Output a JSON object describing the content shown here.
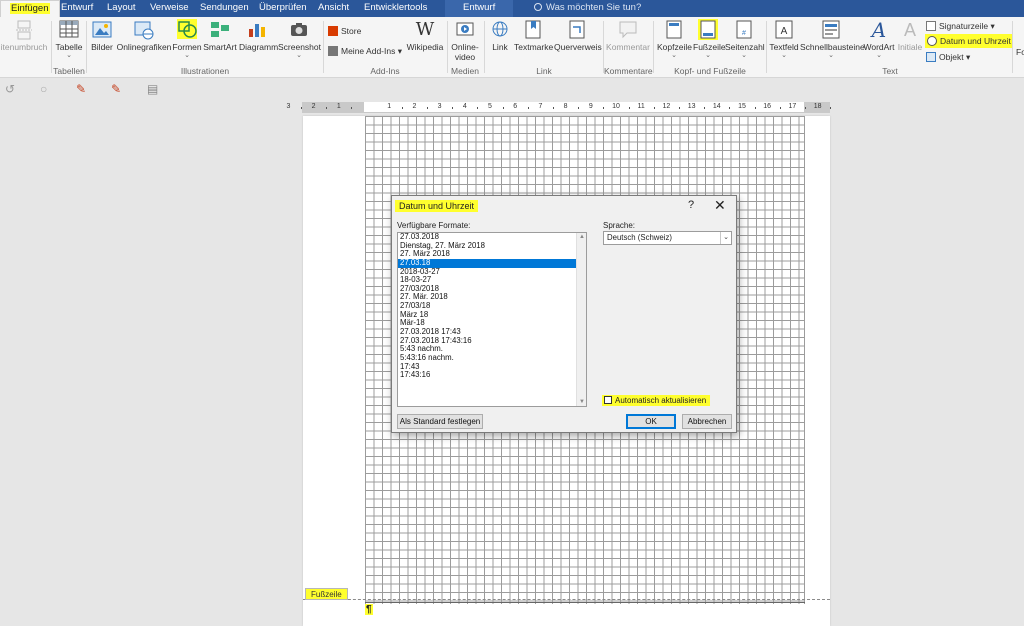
{
  "tabs": [
    "Einfügen",
    "Entwurf",
    "Layout",
    "Verweise",
    "Sendungen",
    "Überprüfen",
    "Ansicht",
    "Entwicklertools",
    "Entwurf"
  ],
  "tell_me": "Was möchten Sie tun?",
  "ribbon": {
    "seitenumbruch": "itenumbruch",
    "tabelle": "Tabelle",
    "bilder": "Bilder",
    "onlinegrafiken": "Onlinegrafiken",
    "formen": "Formen",
    "smartart": "SmartArt",
    "diagramm": "Diagramm",
    "screenshot": "Screenshot",
    "store": "Store",
    "meine_addins": "Meine Add-Ins",
    "wikipedia": "Wikipedia",
    "onlinevideo_1": "Online-",
    "onlinevideo_2": "video",
    "link": "Link",
    "textmarke": "Textmarke",
    "querverweis": "Querverweis",
    "kommentar": "Kommentar",
    "kopfzeile": "Kopfzeile",
    "fusszeile": "Fußzeile",
    "seitenzahl": "Seitenzahl",
    "textfeld": "Textfeld",
    "schnellbausteine": "Schnellbausteine",
    "wordart": "WordArt",
    "initiale": "Initiale",
    "signaturzeile": "Signaturzeile",
    "datum_uhrzeit": "Datum und Uhrzeit",
    "objekt": "Objekt",
    "overflow": "Fo",
    "groups": {
      "tabellen": "Tabellen",
      "illustrationen": "Illustrationen",
      "addins": "Add-Ins",
      "medien": "Medien",
      "link": "Link",
      "kommentare": "Kommentare",
      "kopf_fuss": "Kopf- und Fußzeile",
      "text": "Text"
    }
  },
  "ruler_numbers": [
    "3",
    "2",
    "1",
    "1",
    "2",
    "3",
    "4",
    "5",
    "6",
    "7",
    "8",
    "9",
    "10",
    "11",
    "12",
    "13",
    "14",
    "15",
    "16",
    "17",
    "18"
  ],
  "document": {
    "footer_tag": "Fußzeile",
    "pilcrow": "¶"
  },
  "dialog": {
    "title": "Datum und Uhrzeit",
    "help": "?",
    "close": "✕",
    "formats_label": "Verfügbare Formate:",
    "formats": [
      "27.03.2018",
      "Dienstag, 27. März 2018",
      "27. März 2018",
      "27.03.18",
      "2018-03-27",
      "18-03-27",
      "27/03/2018",
      "27. Mär. 2018",
      "27/03/18",
      "März 18",
      "Mär-18",
      "27.03.2018 17:43",
      "27.03.2018 17:43:16",
      "5:43 nachm.",
      "5:43:16 nachm.",
      "17:43",
      "17:43:16"
    ],
    "selected_index": 3,
    "language_label": "Sprache:",
    "language_value": "Deutsch (Schweiz)",
    "auto_update_label": "Automatisch aktualisieren",
    "auto_update_checked": false,
    "set_default_button": "Als Standard festlegen",
    "ok_button": "OK",
    "cancel_button": "Abbrechen"
  },
  "colors": {
    "title_bar": "#2b579a",
    "highlight": "#ffff2e",
    "selection": "#0078d7"
  }
}
